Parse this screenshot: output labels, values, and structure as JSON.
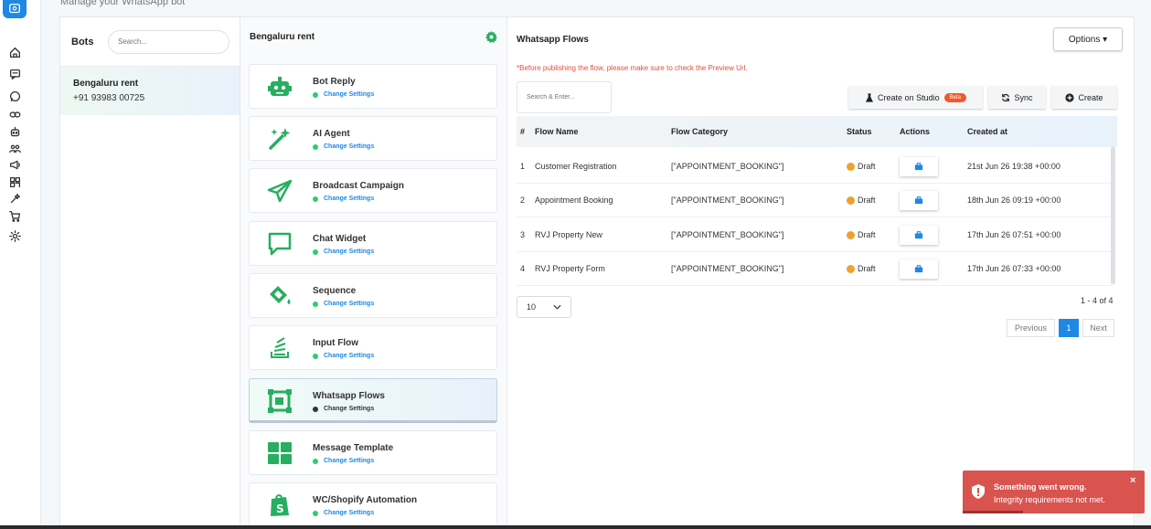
{
  "header": {
    "subtitle": "Manage your WhatsApp bot"
  },
  "rail": {
    "items": [
      "home-icon",
      "chat-icon",
      "whatsapp-icon",
      "link-icon",
      "bot-icon",
      "users-icon",
      "megaphone-icon",
      "qr-icon",
      "magic-icon",
      "cart-icon",
      "settings-icon"
    ]
  },
  "bots": {
    "title": "Bots",
    "search_placeholder": "Search...",
    "items": [
      {
        "name": "Bengaluru rent",
        "phone": "+91 93983 00725"
      }
    ]
  },
  "features": {
    "title": "Bengaluru rent",
    "settings_label": "Change Settings",
    "items": [
      {
        "name": "Bot Reply",
        "icon": "robot-icon",
        "active": false
      },
      {
        "name": "AI Agent",
        "icon": "magic-wand-icon",
        "active": false
      },
      {
        "name": "Broadcast Campaign",
        "icon": "paper-plane-icon",
        "active": false
      },
      {
        "name": "Chat Widget",
        "icon": "chat-bubble-icon",
        "active": false
      },
      {
        "name": "Sequence",
        "icon": "paint-bucket-icon",
        "active": false
      },
      {
        "name": "Input Flow",
        "icon": "stack-icon",
        "active": false
      },
      {
        "name": "Whatsapp Flows",
        "icon": "flow-frame-icon",
        "active": true
      },
      {
        "name": "Message Template",
        "icon": "grid-icon",
        "active": false
      },
      {
        "name": "WC/Shopify Automation",
        "icon": "shopify-icon",
        "active": false
      }
    ]
  },
  "flows": {
    "title": "Whatsapp Flows",
    "options_label": "Options",
    "warning": "*Before publishing the flow, please make sure to check the Preview Url.",
    "search_placeholder": "Search & Enter...",
    "buttons": {
      "studio": "Create on Studio",
      "beta": "Beta",
      "sync": "Sync",
      "create": "Create"
    },
    "columns": {
      "num": "#",
      "name": "Flow Name",
      "category": "Flow Category",
      "status": "Status",
      "actions": "Actions",
      "created": "Created at"
    },
    "rows": [
      {
        "num": "1",
        "name": "Customer Registration",
        "category": "[\"APPOINTMENT_BOOKING\"]",
        "status": "Draft",
        "created": "21st Jun 26 19:38 +00:00"
      },
      {
        "num": "2",
        "name": "Appointment Booking",
        "category": "[\"APPOINTMENT_BOOKING\"]",
        "status": "Draft",
        "created": "18th Jun 26 09:19 +00:00"
      },
      {
        "num": "3",
        "name": "RVJ Property New",
        "category": "[\"APPOINTMENT_BOOKING\"]",
        "status": "Draft",
        "created": "17th Jun 26 07:51 +00:00"
      },
      {
        "num": "4",
        "name": "RVJ Property Form",
        "category": "[\"APPOINTMENT_BOOKING\"]",
        "status": "Draft",
        "created": "17th Jun 26 07:33 +00:00"
      }
    ],
    "page_size": "10",
    "count": "1 - 4 of 4",
    "pager": {
      "prev": "Previous",
      "current": "1",
      "next": "Next"
    }
  },
  "toast": {
    "title": "Something went wrong.",
    "message": "Integrity requirements not met.",
    "close": "×"
  },
  "colors": {
    "accent": "#1e88e5",
    "green": "#2ecc71",
    "draft": "#f0a030",
    "error": "#d9534f"
  }
}
